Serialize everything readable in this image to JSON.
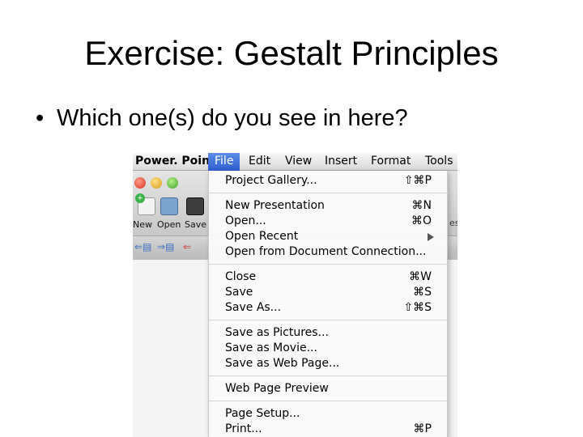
{
  "slide": {
    "title": "Exercise: Gestalt Principles",
    "bullet": "•",
    "question": "Which one(s) do you see in here?"
  },
  "menubar": {
    "app": "Power. Point",
    "items": [
      "File",
      "Edit",
      "View",
      "Insert",
      "Format",
      "Tools"
    ],
    "active": "File"
  },
  "toolbar": {
    "new_label": "New",
    "open_label": "Open",
    "save_label": "Save",
    "right_edge": "es"
  },
  "file_menu": {
    "groups": [
      [
        {
          "label": "Project Gallery...",
          "shortcut": "⇧⌘P"
        }
      ],
      [
        {
          "label": "New Presentation",
          "shortcut": "⌘N"
        },
        {
          "label": "Open...",
          "shortcut": "⌘O"
        },
        {
          "label": "Open Recent",
          "submenu": true
        },
        {
          "label": "Open from Document Connection...",
          "shortcut": ""
        }
      ],
      [
        {
          "label": "Close",
          "shortcut": "⌘W"
        },
        {
          "label": "Save",
          "shortcut": "⌘S"
        },
        {
          "label": "Save As...",
          "shortcut": "⇧⌘S"
        }
      ],
      [
        {
          "label": "Save as Pictures...",
          "shortcut": ""
        },
        {
          "label": "Save as Movie...",
          "shortcut": ""
        },
        {
          "label": "Save as Web Page...",
          "shortcut": ""
        }
      ],
      [
        {
          "label": "Web Page Preview",
          "shortcut": ""
        }
      ],
      [
        {
          "label": "Page Setup...",
          "shortcut": ""
        },
        {
          "label": "Print...",
          "shortcut": "⌘P"
        }
      ]
    ]
  },
  "colors": {
    "menu_highlight": "#2e5fd0",
    "close_button": "#d8321e",
    "minimize_button": "#d89a12",
    "zoom_button": "#3ea42a"
  }
}
